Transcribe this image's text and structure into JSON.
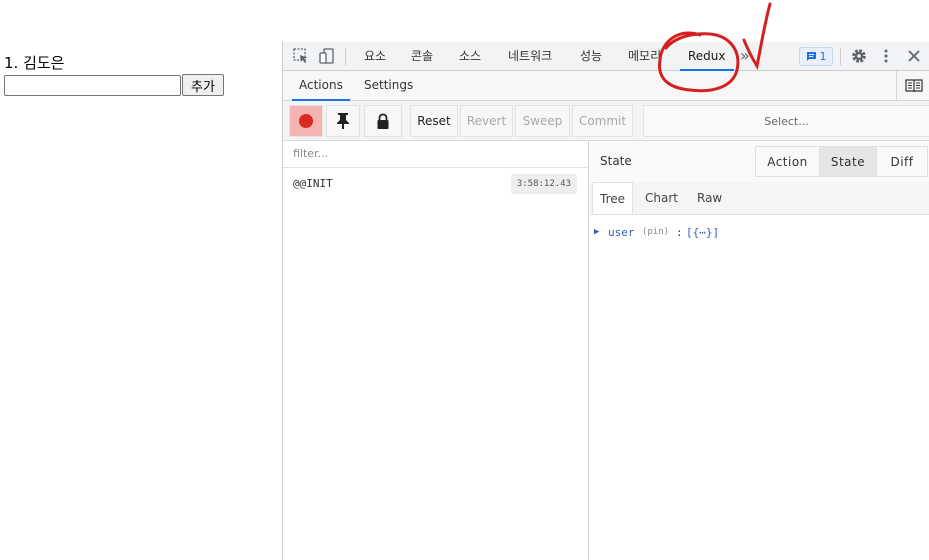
{
  "app": {
    "list_items": [
      "1. 김도은"
    ],
    "input_value": "",
    "add_button": "추가"
  },
  "devtools": {
    "tabs": [
      "요소",
      "콘솔",
      "소스",
      "네트워크",
      "성능",
      "메모리",
      "Redux"
    ],
    "active_tab": "Redux",
    "more_tabs_glyph": "»",
    "message_count": "1",
    "icons": [
      "inspect-icon",
      "device-toggle-icon",
      "messages-icon",
      "gear-icon",
      "kebab-icon",
      "close-icon"
    ],
    "accent_color": "#1a73e8"
  },
  "redux": {
    "panel_tabs": [
      "Actions",
      "Settings"
    ],
    "active_panel_tab": "Actions",
    "toolbar": {
      "reset": "Reset",
      "revert": "Revert",
      "sweep": "Sweep",
      "commit": "Commit",
      "select_placeholder": "Select..."
    },
    "filter_placeholder": "filter...",
    "actions": [
      {
        "name": "@@INIT",
        "time": "3:58:12.43"
      }
    ],
    "state_title": "State",
    "monitor_tabs": [
      "Action",
      "State",
      "Diff"
    ],
    "active_monitor_tab": "State",
    "view_tabs": [
      "Tree",
      "Chart",
      "Raw"
    ],
    "active_view_tab": "Tree",
    "tree": {
      "arrow": "▶",
      "key": "user",
      "pin_label": "(pin)",
      "colon": ":",
      "value_preview": "[{⋯}]"
    }
  },
  "annotation": {
    "color": "#d42020"
  }
}
